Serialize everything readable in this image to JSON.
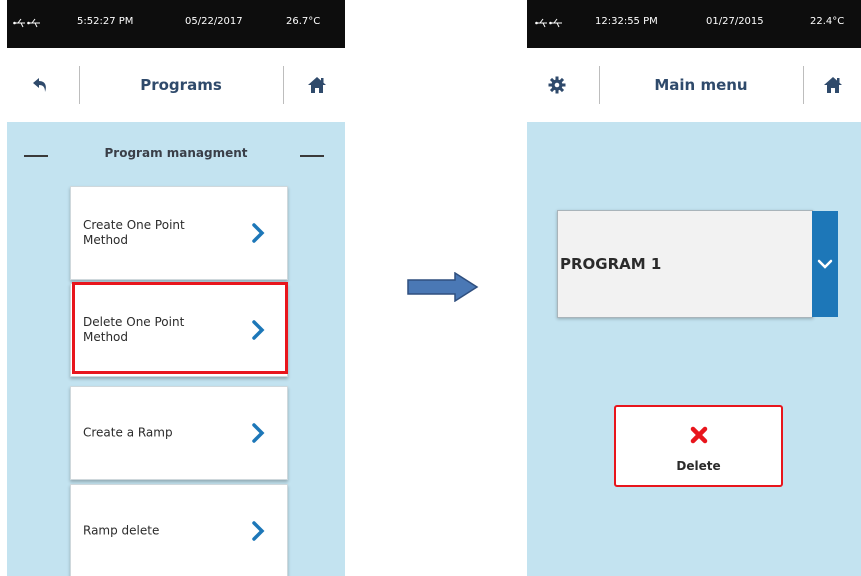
{
  "left_screen": {
    "status": {
      "time": "5:52:27 PM",
      "date": "05/22/2017",
      "temp": "26.7°C"
    },
    "header": {
      "title": "Programs"
    },
    "section_title": "Program managment",
    "items": [
      {
        "label": "Create One Point Method"
      },
      {
        "label": "Delete  One Point Method"
      },
      {
        "label": "Create a Ramp"
      },
      {
        "label": "Ramp delete"
      }
    ]
  },
  "right_screen": {
    "status": {
      "time": "12:32:55 PM",
      "date": "01/27/2015",
      "temp": "22.4°C"
    },
    "header": {
      "title": "Main menu"
    },
    "program_select": {
      "value": "PROGRAM 1"
    },
    "delete_button": {
      "label": "Delete"
    }
  },
  "icons": {
    "back": "back-arrow-icon",
    "home": "home-icon",
    "settings": "gear-icon",
    "chevron": "chevron-right-icon",
    "dropdown": "chevron-down-icon",
    "delete": "x-icon",
    "usb": "usb-icon",
    "transition": "arrow-right-icon"
  },
  "colors": {
    "screen_bg": "#c3e3f0",
    "accent": "#1d77b8",
    "highlight": "#e8151c",
    "title_text": "#2f4a6b"
  }
}
